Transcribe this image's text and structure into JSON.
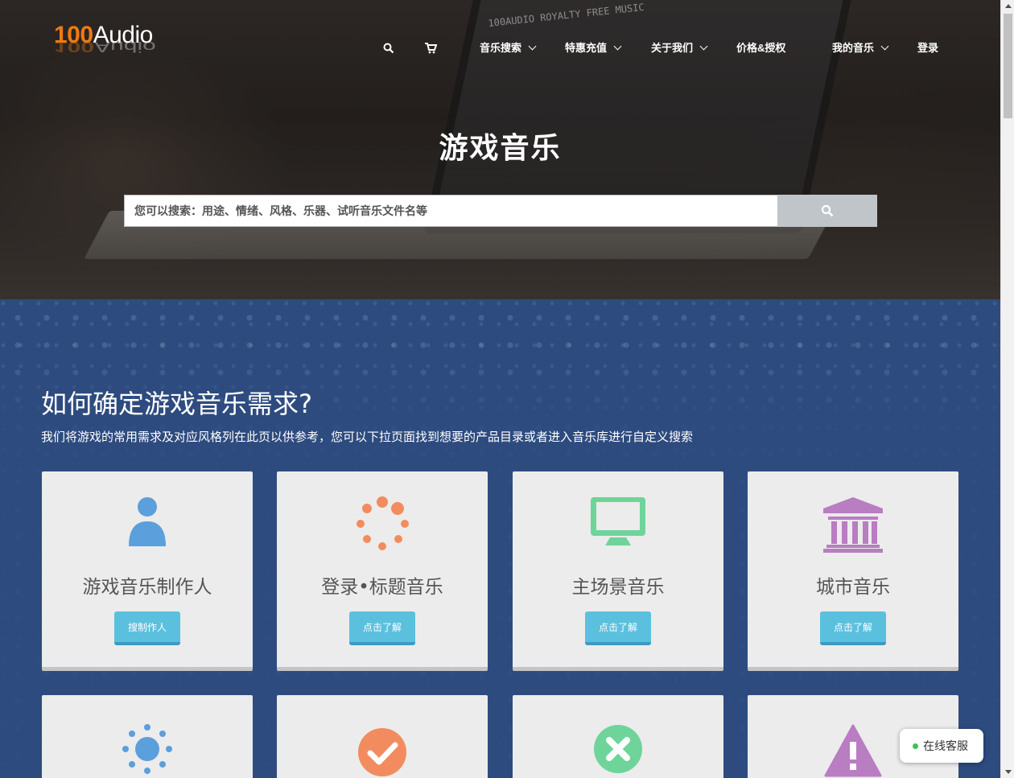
{
  "logo": {
    "number": "100",
    "word": "Audio"
  },
  "screen_text": "100AUDIO ROYALTY FREE MUSIC",
  "nav": {
    "search_icon": "search-icon",
    "cart_icon": "cart-icon",
    "items": [
      {
        "label": "音乐搜索",
        "dropdown": true
      },
      {
        "label": "特惠充值",
        "dropdown": true
      },
      {
        "label": "关于我们",
        "dropdown": true
      },
      {
        "label": "价格&授权",
        "dropdown": false
      },
      {
        "label": "我的音乐",
        "dropdown": true
      },
      {
        "label": "登录",
        "dropdown": false
      }
    ]
  },
  "hero": {
    "title": "游戏音乐",
    "search_placeholder": "您可以搜索：用途、情绪、风格、乐器、试听音乐文件名等",
    "search_value": ""
  },
  "section": {
    "title": "如何确定游戏音乐需求?",
    "subtitle": "我们将游戏的常用需求及对应风格列在此页以供参考，您可以下拉页面找到想要的产品目录或者进入音乐库进行自定义搜索"
  },
  "cards": [
    {
      "title": "游戏音乐制作人",
      "button": "搜制作人",
      "icon": "user-icon",
      "color": "#5b9fdc"
    },
    {
      "title": "登录•标题音乐",
      "button": "点击了解",
      "icon": "spinner-icon",
      "color": "#f28c5e"
    },
    {
      "title": "主场景音乐",
      "button": "点击了解",
      "icon": "monitor-icon",
      "color": "#6fd49a"
    },
    {
      "title": "城市音乐",
      "button": "点击了解",
      "icon": "bank-icon",
      "color": "#b97dc2"
    },
    {
      "title": "",
      "button": "",
      "icon": "sun-icon",
      "color": "#5b9fdc"
    },
    {
      "title": "",
      "button": "",
      "icon": "check-circle-icon",
      "color": "#f28c5e"
    },
    {
      "title": "",
      "button": "",
      "icon": "close-circle-icon",
      "color": "#6fd49a"
    },
    {
      "title": "",
      "button": "",
      "icon": "warning-icon",
      "color": "#b97dc2"
    }
  ],
  "chat": {
    "label": "在线客服",
    "status_color": "#3cc25a"
  },
  "colors": {
    "accent": "#ef7a12",
    "content_bg": "#2d4b7f",
    "button": "#5bc0de"
  }
}
